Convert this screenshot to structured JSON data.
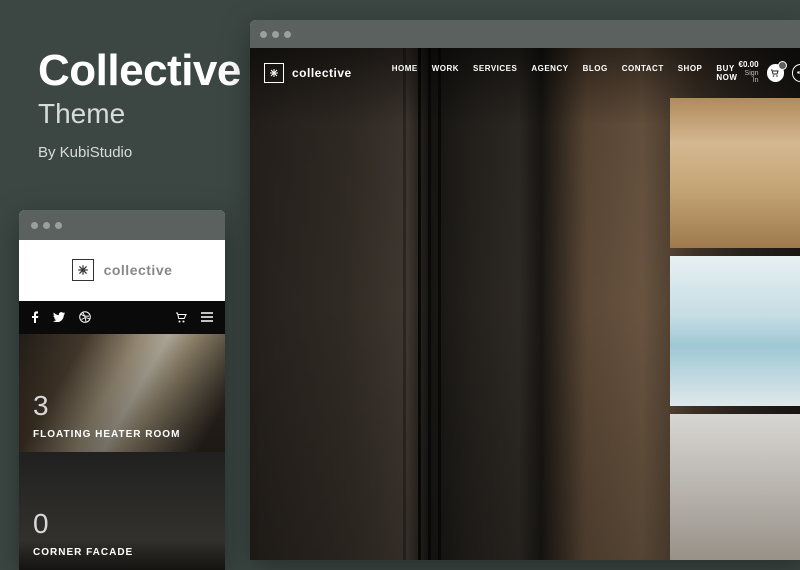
{
  "title": {
    "main": "Collective",
    "sub": "Theme",
    "author": "By KubiStudio"
  },
  "desktop": {
    "brand": "collective",
    "nav": [
      "HOME",
      "WORK",
      "SERVICES",
      "AGENCY",
      "BLOG",
      "CONTACT",
      "SHOP",
      "BUY NOW"
    ],
    "price": "€0.00",
    "signin": "Sign In"
  },
  "mobile": {
    "brand": "collective",
    "cards": [
      {
        "num": "3",
        "label": "FLOATING HEATER ROOM"
      },
      {
        "num": "0",
        "label": "CORNER FACADE"
      }
    ]
  }
}
